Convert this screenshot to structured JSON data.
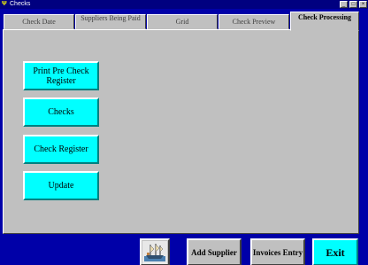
{
  "window": {
    "title": "Checks",
    "minimize_glyph": "_",
    "maximize_glyph": "□",
    "close_glyph": "×"
  },
  "tabs": [
    {
      "label": "Check Date"
    },
    {
      "label": "Suppliers Being Paid"
    },
    {
      "label": "Grid"
    },
    {
      "label": "Check Preview"
    },
    {
      "label": "Check Processing",
      "active": true
    }
  ],
  "actions": {
    "print_pre_check_register": "Print Pre Check Register",
    "checks": "Checks",
    "check_register": "Check Register",
    "update": "Update"
  },
  "bottom": {
    "picture_button_icon": "ship-icon",
    "add_supplier": "Add Supplier",
    "invoices_entry": "Invoices Entry",
    "exit": "Exit"
  },
  "colors": {
    "background": "#0000a8",
    "panel": "#c0c0c0",
    "accent_button": "#00ffff"
  }
}
